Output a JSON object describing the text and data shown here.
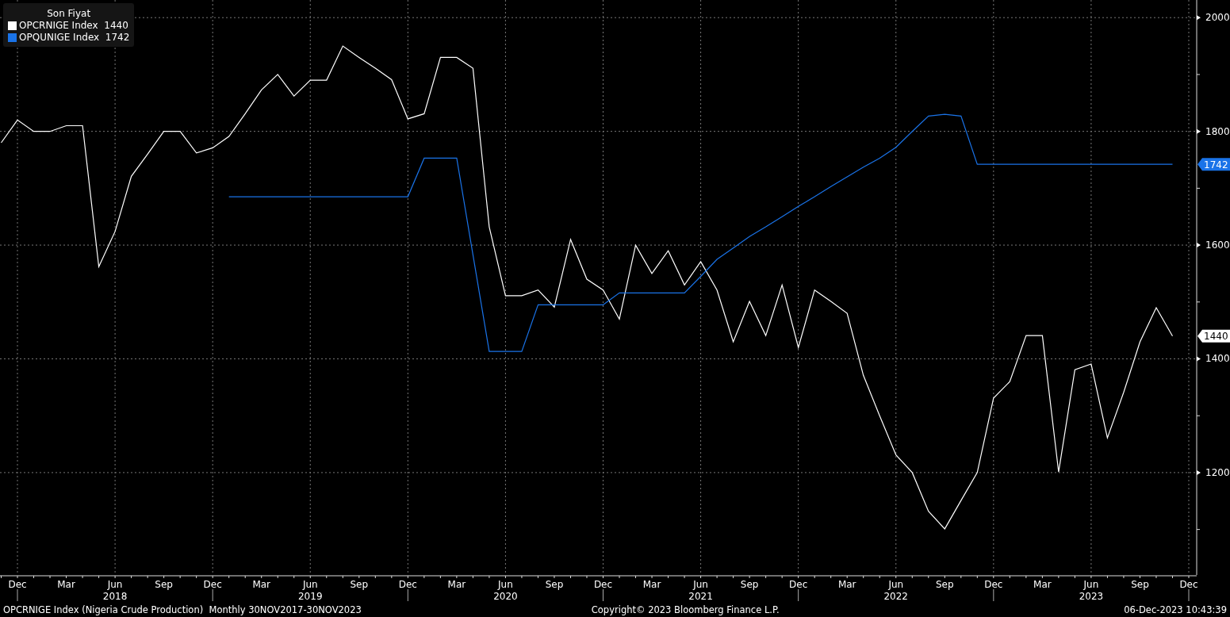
{
  "chart": {
    "legend": {
      "title": "Son Fiyat",
      "items": [
        {
          "value": "1440"
        },
        {
          "value": "1742"
        }
      ]
    },
    "last_value_badges": [
      {
        "label": "1742",
        "color": "#1a73e8"
      },
      {
        "label": "1440",
        "color": "#ffffff"
      }
    ],
    "year_labels": [
      "2018",
      "2019",
      "2020",
      "2021",
      "2022",
      "2023"
    ],
    "chart_data": {
      "type": "line",
      "grid": true,
      "categories": [
        null,
        "Dec",
        null,
        null,
        "Mar",
        null,
        null,
        "Jun",
        null,
        null,
        "Sep",
        null,
        null,
        "Dec",
        null,
        null,
        "Mar",
        null,
        null,
        "Jun",
        null,
        null,
        "Sep",
        null,
        null,
        "Dec",
        null,
        null,
        "Mar",
        null,
        null,
        "Jun",
        null,
        null,
        "Sep",
        null,
        null,
        "Dec",
        null,
        null,
        "Mar",
        null,
        null,
        "Jun",
        null,
        null,
        "Sep",
        null,
        null,
        "Dec",
        null,
        null,
        "Mar",
        null,
        null,
        "Jun",
        null,
        null,
        "Sep",
        null,
        null,
        "Dec",
        null,
        null,
        "Mar",
        null,
        null,
        "Jun",
        null,
        null,
        "Sep",
        null,
        null,
        "Dec"
      ],
      "series": [
        {
          "name": "OPCRNIGE Index",
          "color": "#ffffff",
          "values": [
            1780,
            1820,
            1800,
            1800,
            1810,
            1810,
            1562,
            1624,
            1721,
            1760,
            1800,
            1800,
            1762,
            1771,
            1791,
            1831,
            1873,
            1900,
            1862,
            1890,
            1890,
            1950,
            1930,
            1911,
            1891,
            1822,
            1831,
            1930,
            1930,
            1911,
            1632,
            1511,
            1511,
            1521,
            1491,
            1610,
            1540,
            1521,
            1470,
            1600,
            1550,
            1590,
            1530,
            1571,
            1521,
            1430,
            1501,
            1441,
            1530,
            1420,
            1521,
            1501,
            1480,
            1371,
            1300,
            1231,
            1200,
            1132,
            1101,
            1151,
            1200,
            1331,
            1360,
            1441,
            1441,
            1201,
            1381,
            1391,
            1261,
            1341,
            1430,
            1490,
            1440,
            null
          ]
        },
        {
          "name": "OPQUNIGE Index",
          "color": "#1a73e8",
          "values": [
            null,
            null,
            null,
            null,
            null,
            null,
            null,
            null,
            null,
            null,
            null,
            null,
            null,
            null,
            1685,
            1685,
            1685,
            1685,
            1685,
            1685,
            1685,
            1685,
            1685,
            1685,
            1685,
            1685,
            1753,
            1753,
            1753,
            1583,
            1413,
            1413,
            1413,
            1495,
            1495,
            1495,
            1495,
            1495,
            1516,
            1516,
            1516,
            1516,
            1516,
            1545,
            1575,
            1595,
            1615,
            1632,
            1650,
            1668,
            1685,
            1703,
            1720,
            1737,
            1753,
            1772,
            1800,
            1827,
            1830,
            1827,
            1742,
            1742,
            1742,
            1742,
            1742,
            1742,
            1742,
            1742,
            1742,
            1742,
            1742,
            1742,
            1742,
            null
          ]
        }
      ],
      "ylim": [
        1020,
        2031
      ],
      "yticks": [
        1200,
        1400,
        1600,
        1800,
        2000
      ]
    }
  },
  "footer": {
    "description": "OPCRNIGE Index (Nigeria Crude Production)  Monthly 30NOV2017-30NOV2023",
    "copyright": "Copyright© 2023 Bloomberg Finance L.P.",
    "timestamp": "06-Dec-2023 10:43:39"
  }
}
